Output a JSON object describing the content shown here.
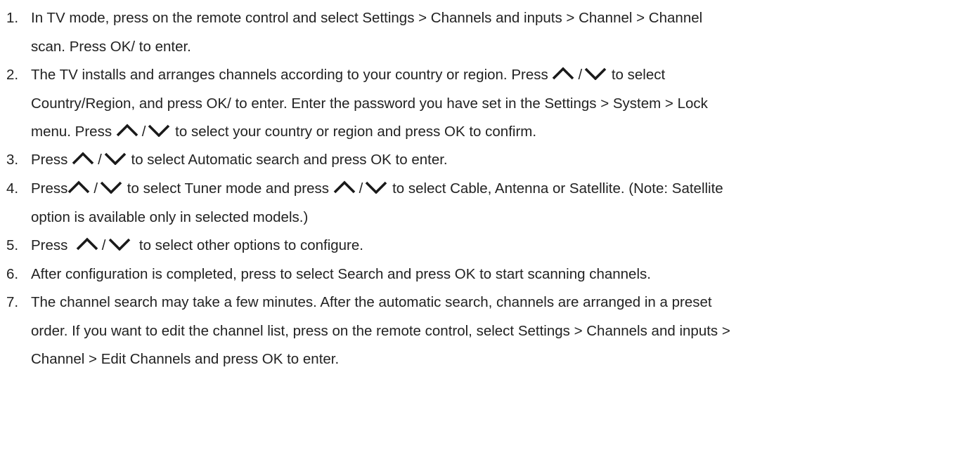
{
  "steps": [
    {
      "number": "1.",
      "lines": [
        [
          "In TV mode, press on the remote control and select Settings > Channels and inputs > Channel > Channel"
        ],
        [
          "scan. Press OK/ to enter."
        ]
      ]
    },
    {
      "number": "2.",
      "lines": [
        [
          "The TV installs and arranges channels according to your country or region. Press ",
          "ARROWS",
          " to select"
        ],
        [
          "Country/Region, and press OK/ to enter. Enter the password you have set in the Settings > System > Lock"
        ],
        [
          "menu. Press ",
          "ARROWS",
          " to select your country or region and press OK to confirm."
        ]
      ]
    },
    {
      "number": "3.",
      "lines": [
        [
          "Press ",
          "ARROWS",
          " to select Automatic search and press OK to enter."
        ]
      ]
    },
    {
      "number": "4.",
      "lines": [
        [
          "Press",
          "ARROWS",
          " to select Tuner mode and press ",
          "ARROWS",
          " to select Cable, Antenna or Satellite. (Note: Satellite"
        ],
        [
          "option is available only in selected models.)"
        ]
      ]
    },
    {
      "number": "5.",
      "lines": [
        [
          "Press  ",
          "ARROWS",
          "  to select other options to configure."
        ]
      ]
    },
    {
      "number": "6.",
      "lines": [
        [
          "After configuration is completed, press to select Search and press OK to start scanning channels."
        ]
      ]
    },
    {
      "number": "7.",
      "lines": [
        [
          "The channel search may take a few minutes. After the automatic search, channels are arranged in a preset"
        ],
        [
          "order. If you want to edit the channel list, press on the remote control, select Settings > Channels and inputs >"
        ],
        [
          "Channel > Edit Channels and press OK to enter."
        ]
      ]
    }
  ],
  "arrow_separator": "/",
  "icons": {
    "up": "chevron-up-icon",
    "down": "chevron-down-icon"
  },
  "colors": {
    "text": "#222222",
    "icon": "#1a1a1a"
  }
}
